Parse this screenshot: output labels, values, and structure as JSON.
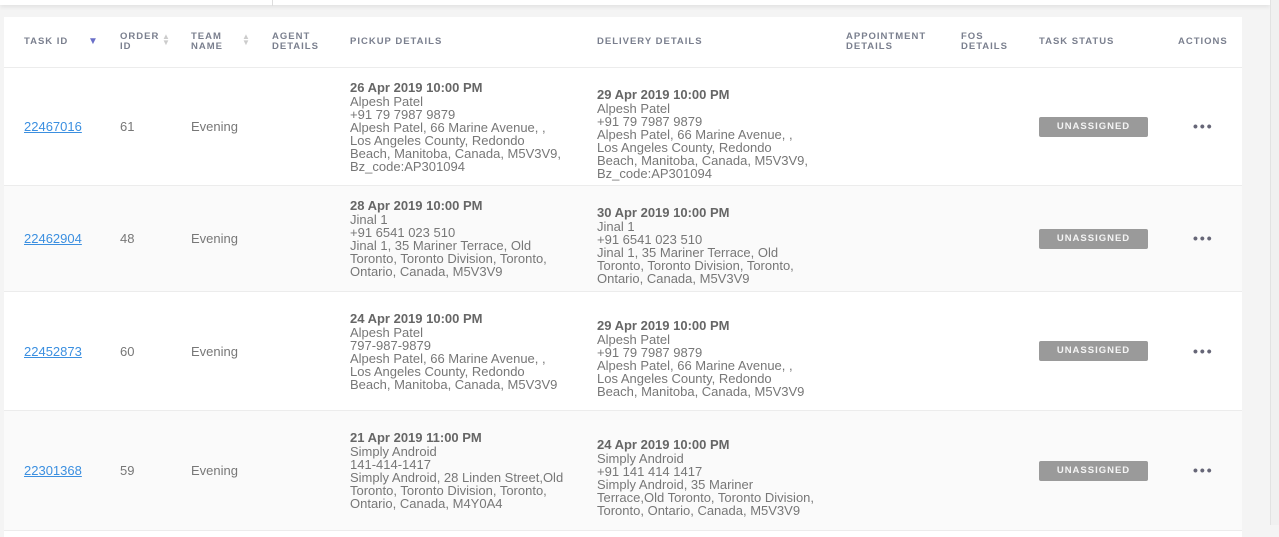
{
  "table": {
    "columns": {
      "task_id": "TASK ID",
      "order_id": "ORDER ID",
      "team_name": "TEAM NAME",
      "agent_details": "AGENT DETAILS",
      "pickup_details": "PICKUP DETAILS",
      "delivery_details": "DELIVERY DETAILS",
      "appointment_details": "APPOINTMENT DETAILS",
      "fos_details": "FOS DETAILS",
      "task_status": "TASK STATUS",
      "actions": "ACTIONS"
    },
    "sort": {
      "column": "task_id",
      "direction": "descending"
    },
    "rows": [
      {
        "task_id": "22467016",
        "order_id": "61",
        "team": "Evening",
        "pickup": {
          "datetime": "26 Apr 2019 10:00 PM",
          "name": "Alpesh Patel",
          "phone": "+91 79 7987 9879",
          "address": "Alpesh Patel, 66 Marine Avenue, , Los Angeles County, Redondo Beach, Manitoba, Canada, M5V3V9, Bz_code:AP301094"
        },
        "delivery": {
          "datetime": "29 Apr 2019 10:00 PM",
          "name": "Alpesh Patel",
          "phone": "+91 79 7987 9879",
          "address": "Alpesh Patel, 66 Marine Avenue, , Los Angeles County, Redondo Beach, Manitoba, Canada, M5V3V9, Bz_code:AP301094"
        },
        "status": "UNASSIGNED"
      },
      {
        "task_id": "22462904",
        "order_id": "48",
        "team": "Evening",
        "pickup": {
          "datetime": "28 Apr 2019 10:00 PM",
          "name": "Jinal 1",
          "phone": "+91 6541 023 510",
          "address": "Jinal 1, 35 Mariner Terrace, Old Toronto, Toronto Division, Toronto, Ontario, Canada, M5V3V9"
        },
        "delivery": {
          "datetime": "30 Apr 2019 10:00 PM",
          "name": "Jinal 1",
          "phone": "+91 6541 023 510",
          "address": "Jinal 1, 35 Mariner Terrace, Old Toronto, Toronto Division, Toronto, Ontario, Canada, M5V3V9"
        },
        "status": "UNASSIGNED"
      },
      {
        "task_id": "22452873",
        "order_id": "60",
        "team": "Evening",
        "pickup": {
          "datetime": "24 Apr 2019 10:00 PM",
          "name": "Alpesh Patel",
          "phone": "797-987-9879",
          "address": "Alpesh Patel, 66 Marine Avenue, , Los Angeles County, Redondo Beach, Manitoba, Canada, M5V3V9"
        },
        "delivery": {
          "datetime": "29 Apr 2019 10:00 PM",
          "name": "Alpesh Patel",
          "phone": "+91 79 7987 9879",
          "address": "Alpesh Patel, 66 Marine Avenue, , Los Angeles County, Redondo Beach, Manitoba, Canada, M5V3V9"
        },
        "status": "UNASSIGNED"
      },
      {
        "task_id": "22301368",
        "order_id": "59",
        "team": "Evening",
        "pickup": {
          "datetime": "21 Apr 2019 11:00 PM",
          "name": "Simply Android",
          "phone": "141-414-1417",
          "address": "Simply Android, 28 Linden Street,Old Toronto, Toronto Division, Toronto, Ontario, Canada, M4Y0A4"
        },
        "delivery": {
          "datetime": "24 Apr 2019 10:00 PM",
          "name": "Simply Android",
          "phone": "+91 141 414 1417",
          "address": "Simply Android, 35 Mariner Terrace,Old Toronto, Toronto Division, Toronto, Ontario, Canada, M5V3V9"
        },
        "status": "UNASSIGNED"
      }
    ]
  }
}
